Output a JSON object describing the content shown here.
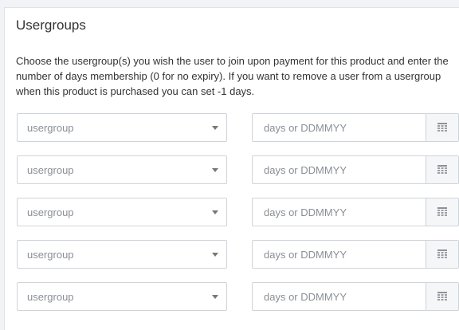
{
  "header": {
    "title": "Usergroups"
  },
  "description": "Choose the usergroup(s) you wish the user to join upon payment for this product and enter the number of days membership (0 for no expiry). If you want to remove a user from a usergroup when this product is purchased you can set -1 days.",
  "rows": [
    {
      "usergroup_placeholder": "usergroup",
      "days_placeholder": "days or DDMMYY"
    },
    {
      "usergroup_placeholder": "usergroup",
      "days_placeholder": "days or DDMMYY"
    },
    {
      "usergroup_placeholder": "usergroup",
      "days_placeholder": "days or DDMMYY"
    },
    {
      "usergroup_placeholder": "usergroup",
      "days_placeholder": "days or DDMMYY"
    },
    {
      "usergroup_placeholder": "usergroup",
      "days_placeholder": "days or DDMMYY"
    }
  ],
  "icons": {
    "caret": "chevron-down-icon",
    "calendar": "calendar-icon"
  },
  "colors": {
    "border": "#cfd4da",
    "placeholder": "#8a8f95",
    "addon_bg": "#f5f6f8"
  }
}
